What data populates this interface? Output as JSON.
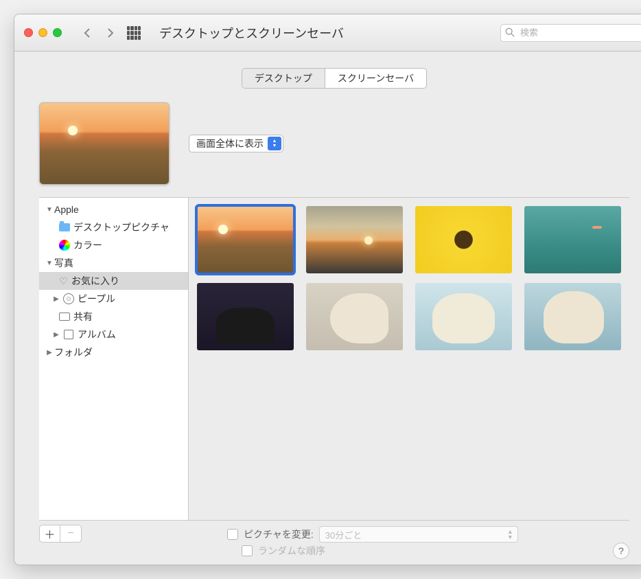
{
  "titlebar": {
    "title": "デスクトップとスクリーンセーバ",
    "search_placeholder": "検索"
  },
  "tabs": {
    "desktop": "デスクトップ",
    "screensaver": "スクリーンセーバ"
  },
  "fill_mode": {
    "selected": "画面全体に表示"
  },
  "sidebar": {
    "apple": {
      "label": "Apple",
      "desktop_pictures": "デスクトップピクチャ",
      "colors": "カラー"
    },
    "photos": {
      "label": "写真",
      "favorites": "お気に入り",
      "people": "ピープル",
      "shared": "共有",
      "albums": "アルバム"
    },
    "folders": {
      "label": "フォルダ"
    }
  },
  "options": {
    "change_picture_label": "ピクチャを変更:",
    "interval": "30分ごと",
    "random_label": "ランダムな順序"
  }
}
